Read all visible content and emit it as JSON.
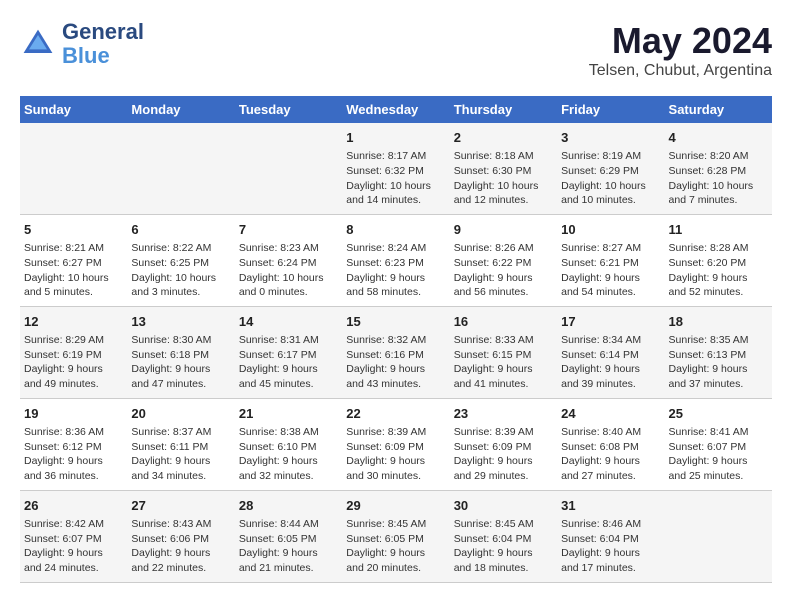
{
  "header": {
    "logo_line1": "General",
    "logo_line2": "Blue",
    "main_title": "May 2024",
    "subtitle": "Telsen, Chubut, Argentina"
  },
  "weekdays": [
    "Sunday",
    "Monday",
    "Tuesday",
    "Wednesday",
    "Thursday",
    "Friday",
    "Saturday"
  ],
  "weeks": [
    [
      {
        "day": "",
        "info": ""
      },
      {
        "day": "",
        "info": ""
      },
      {
        "day": "",
        "info": ""
      },
      {
        "day": "1",
        "info": "Sunrise: 8:17 AM\nSunset: 6:32 PM\nDaylight: 10 hours\nand 14 minutes."
      },
      {
        "day": "2",
        "info": "Sunrise: 8:18 AM\nSunset: 6:30 PM\nDaylight: 10 hours\nand 12 minutes."
      },
      {
        "day": "3",
        "info": "Sunrise: 8:19 AM\nSunset: 6:29 PM\nDaylight: 10 hours\nand 10 minutes."
      },
      {
        "day": "4",
        "info": "Sunrise: 8:20 AM\nSunset: 6:28 PM\nDaylight: 10 hours\nand 7 minutes."
      }
    ],
    [
      {
        "day": "5",
        "info": "Sunrise: 8:21 AM\nSunset: 6:27 PM\nDaylight: 10 hours\nand 5 minutes."
      },
      {
        "day": "6",
        "info": "Sunrise: 8:22 AM\nSunset: 6:25 PM\nDaylight: 10 hours\nand 3 minutes."
      },
      {
        "day": "7",
        "info": "Sunrise: 8:23 AM\nSunset: 6:24 PM\nDaylight: 10 hours\nand 0 minutes."
      },
      {
        "day": "8",
        "info": "Sunrise: 8:24 AM\nSunset: 6:23 PM\nDaylight: 9 hours\nand 58 minutes."
      },
      {
        "day": "9",
        "info": "Sunrise: 8:26 AM\nSunset: 6:22 PM\nDaylight: 9 hours\nand 56 minutes."
      },
      {
        "day": "10",
        "info": "Sunrise: 8:27 AM\nSunset: 6:21 PM\nDaylight: 9 hours\nand 54 minutes."
      },
      {
        "day": "11",
        "info": "Sunrise: 8:28 AM\nSunset: 6:20 PM\nDaylight: 9 hours\nand 52 minutes."
      }
    ],
    [
      {
        "day": "12",
        "info": "Sunrise: 8:29 AM\nSunset: 6:19 PM\nDaylight: 9 hours\nand 49 minutes."
      },
      {
        "day": "13",
        "info": "Sunrise: 8:30 AM\nSunset: 6:18 PM\nDaylight: 9 hours\nand 47 minutes."
      },
      {
        "day": "14",
        "info": "Sunrise: 8:31 AM\nSunset: 6:17 PM\nDaylight: 9 hours\nand 45 minutes."
      },
      {
        "day": "15",
        "info": "Sunrise: 8:32 AM\nSunset: 6:16 PM\nDaylight: 9 hours\nand 43 minutes."
      },
      {
        "day": "16",
        "info": "Sunrise: 8:33 AM\nSunset: 6:15 PM\nDaylight: 9 hours\nand 41 minutes."
      },
      {
        "day": "17",
        "info": "Sunrise: 8:34 AM\nSunset: 6:14 PM\nDaylight: 9 hours\nand 39 minutes."
      },
      {
        "day": "18",
        "info": "Sunrise: 8:35 AM\nSunset: 6:13 PM\nDaylight: 9 hours\nand 37 minutes."
      }
    ],
    [
      {
        "day": "19",
        "info": "Sunrise: 8:36 AM\nSunset: 6:12 PM\nDaylight: 9 hours\nand 36 minutes."
      },
      {
        "day": "20",
        "info": "Sunrise: 8:37 AM\nSunset: 6:11 PM\nDaylight: 9 hours\nand 34 minutes."
      },
      {
        "day": "21",
        "info": "Sunrise: 8:38 AM\nSunset: 6:10 PM\nDaylight: 9 hours\nand 32 minutes."
      },
      {
        "day": "22",
        "info": "Sunrise: 8:39 AM\nSunset: 6:09 PM\nDaylight: 9 hours\nand 30 minutes."
      },
      {
        "day": "23",
        "info": "Sunrise: 8:39 AM\nSunset: 6:09 PM\nDaylight: 9 hours\nand 29 minutes."
      },
      {
        "day": "24",
        "info": "Sunrise: 8:40 AM\nSunset: 6:08 PM\nDaylight: 9 hours\nand 27 minutes."
      },
      {
        "day": "25",
        "info": "Sunrise: 8:41 AM\nSunset: 6:07 PM\nDaylight: 9 hours\nand 25 minutes."
      }
    ],
    [
      {
        "day": "26",
        "info": "Sunrise: 8:42 AM\nSunset: 6:07 PM\nDaylight: 9 hours\nand 24 minutes."
      },
      {
        "day": "27",
        "info": "Sunrise: 8:43 AM\nSunset: 6:06 PM\nDaylight: 9 hours\nand 22 minutes."
      },
      {
        "day": "28",
        "info": "Sunrise: 8:44 AM\nSunset: 6:05 PM\nDaylight: 9 hours\nand 21 minutes."
      },
      {
        "day": "29",
        "info": "Sunrise: 8:45 AM\nSunset: 6:05 PM\nDaylight: 9 hours\nand 20 minutes."
      },
      {
        "day": "30",
        "info": "Sunrise: 8:45 AM\nSunset: 6:04 PM\nDaylight: 9 hours\nand 18 minutes."
      },
      {
        "day": "31",
        "info": "Sunrise: 8:46 AM\nSunset: 6:04 PM\nDaylight: 9 hours\nand 17 minutes."
      },
      {
        "day": "",
        "info": ""
      }
    ]
  ]
}
